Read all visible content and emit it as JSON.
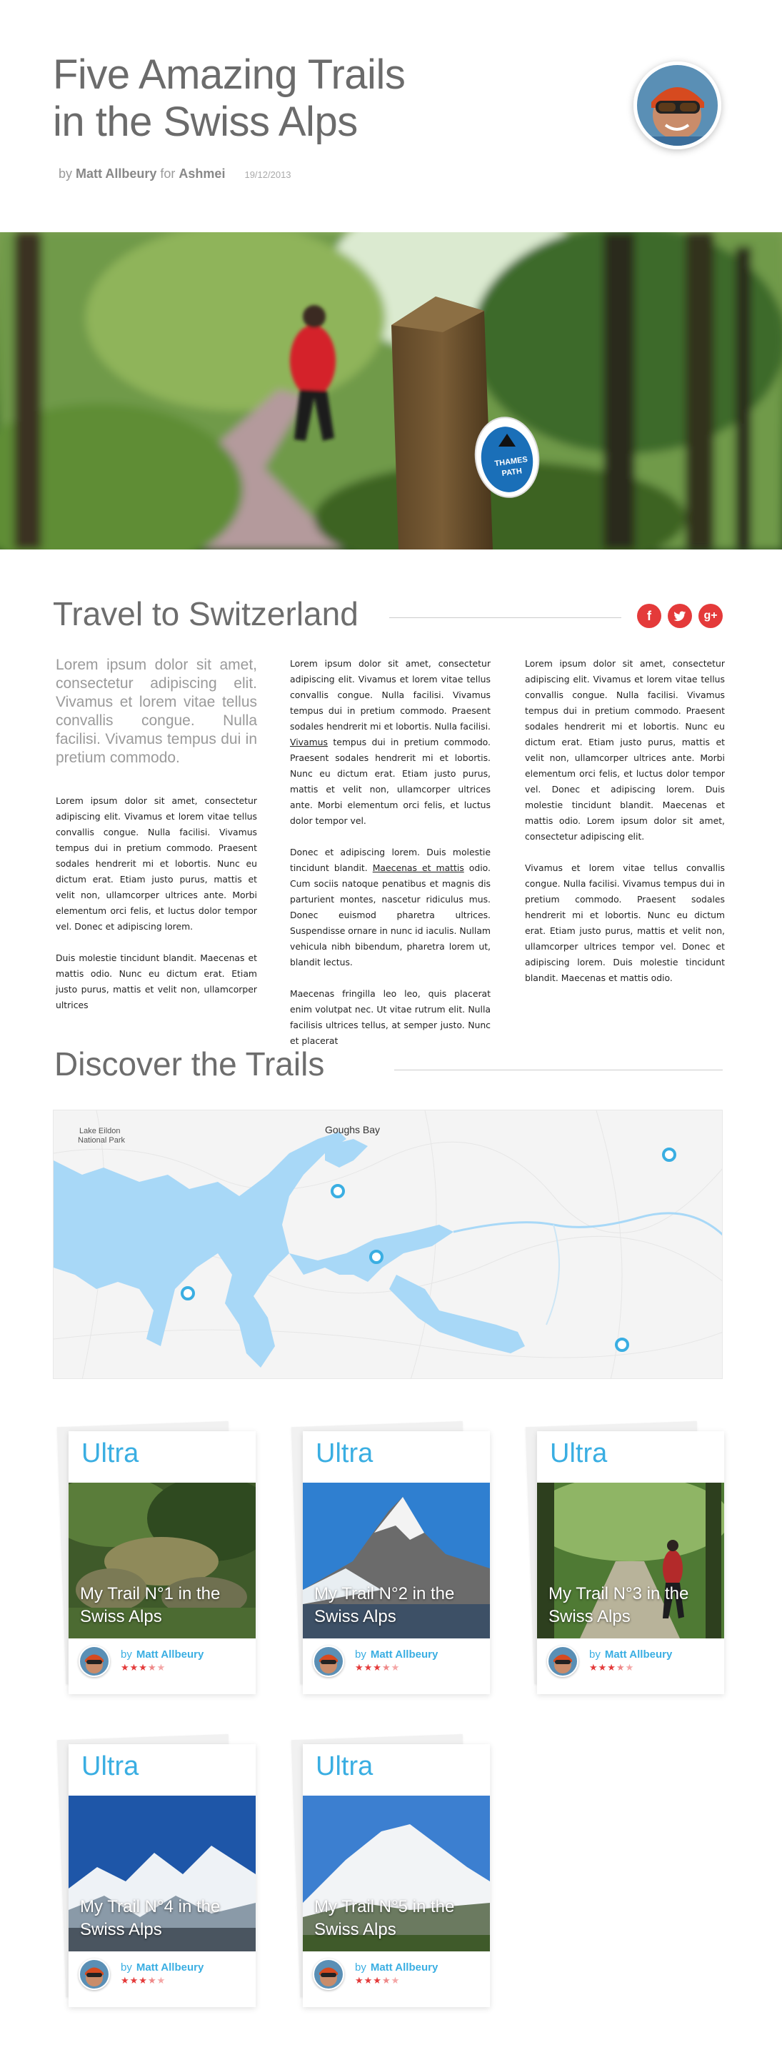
{
  "header": {
    "title_line1": "Five Amazing Trails",
    "title_line2": "in the Swiss Alps",
    "by_label": "by",
    "author": "Matt Allbeury",
    "for_label": "for",
    "site": "Ashmei",
    "date": "19/12/2013"
  },
  "hero": {
    "sign_text_1": "THAMES",
    "sign_text_2": "PATH"
  },
  "travel": {
    "heading": "Travel to Switzerland",
    "social": [
      {
        "icon": "facebook-icon",
        "glyph": "f"
      },
      {
        "icon": "twitter-icon",
        "glyph": "t"
      },
      {
        "icon": "google-plus-icon",
        "glyph": "g+"
      }
    ],
    "lead": "Lorem ipsum dolor sit amet, consectetur adipiscing elit. Vivamus et lorem vitae tellus convallis congue. Nulla facilisi. Vivamus tempus dui in pretium commodo.",
    "col1_p1": "Lorem ipsum dolor sit amet, consectetur adipiscing elit. Vivamus et lorem vitae tellus convallis congue. Nulla facilisi. Vivamus tempus dui in pretium commodo. Praesent sodales hendrerit mi et lobortis. Nunc eu dictum erat. Etiam justo purus, mattis et velit non, ullamcorper ultrices ante. Morbi elementum orci felis, et luctus dolor tempor vel. Donec et adipiscing lorem.",
    "col1_p2": "Duis molestie tincidunt blandit. Maecenas et mattis odio. Nunc eu dictum erat. Etiam justo purus, mattis et velit non, ullamcorper ultrices",
    "col2_p1a": "Lorem ipsum dolor sit amet, consectetur adipiscing elit. Vivamus et lorem vitae tellus convallis congue. Nulla facilisi. Vivamus tempus dui in pretium commodo. Praesent sodales hendrerit mi et lobortis.  Nulla facilisi. ",
    "col2_p1_link": "Vivamus",
    "col2_p1b": " tempus dui in pretium commodo. Praesent sodales hendrerit mi et lobortis. Nunc eu dictum erat. Etiam justo purus, mattis et velit non, ullamcorper ultrices ante. Morbi elementum orci felis, et luctus dolor tempor vel.",
    "col2_p2a": "Donec et adipiscing lorem. Duis molestie tincidunt blandit. ",
    "col2_p2_link": "Maecenas et mattis",
    "col2_p2b": " odio. Cum sociis natoque penatibus et magnis dis parturient montes, nascetur ridiculus mus. Donec euismod pharetra ultrices. Suspendisse ornare in nunc id iaculis. Nullam vehicula nibh bibendum, pharetra lorem ut, blandit lectus.",
    "col2_p3": "Maecenas fringilla leo leo, quis placerat enim volutpat nec. Ut vitae rutrum elit. Nulla facilisis ultrices tellus, at semper justo. Nunc et placerat",
    "col3_p1": "Lorem ipsum dolor sit amet, consectetur adipiscing elit. Vivamus et lorem vitae tellus convallis congue. Nulla facilisi. Vivamus tempus dui in pretium commodo. Praesent sodales hendrerit mi et lobortis. Nunc eu dictum erat. Etiam justo purus, mattis et velit non, ullamcorper ultrices ante. Morbi elementum orci felis, et luctus dolor tempor vel. Donec et adipiscing lorem. Duis molestie tincidunt blandit. Maecenas et mattis odio. Lorem ipsum dolor sit amet, consectetur adipiscing elit.",
    "col3_p2": "Vivamus et lorem vitae tellus convallis congue. Nulla facilisi. Vivamus tempus dui in pretium commodo. Praesent sodales hendrerit mi et lobortis. Nunc eu dictum erat. Etiam justo purus, mattis et velit non, ullamcorper ultrices tempor vel. Donec et adipiscing lorem. Duis molestie tincidunt blandit. Maecenas et mattis odio."
  },
  "discover": {
    "heading": "Discover the Trails",
    "map_label_1a": "Lake Eildon",
    "map_label_1b": "National Park",
    "map_label_2": "Goughs Bay"
  },
  "cards": [
    {
      "tag": "Ultra",
      "title": "My Trail N°1 in the Swiss Alps",
      "by": "by",
      "author": "Matt Allbeury",
      "rating": 3.5
    },
    {
      "tag": "Ultra",
      "title": "My Trail N°2 in the Swiss Alps",
      "by": "by",
      "author": "Matt Allbeury",
      "rating": 3.5
    },
    {
      "tag": "Ultra",
      "title": "My Trail N°3 in the Swiss Alps",
      "by": "by",
      "author": "Matt Allbeury",
      "rating": 3.5
    },
    {
      "tag": "Ultra",
      "title": "My Trail N°4 in the Swiss Alps",
      "by": "by",
      "author": "Matt Allbeury",
      "rating": 3.5
    },
    {
      "tag": "Ultra",
      "title": "My Trail N°5 in the Swiss Alps",
      "by": "by",
      "author": "Matt Allbeury",
      "rating": 3.5
    }
  ],
  "colors": {
    "accent_blue": "#3aaee2",
    "accent_red": "#e43a3a"
  }
}
